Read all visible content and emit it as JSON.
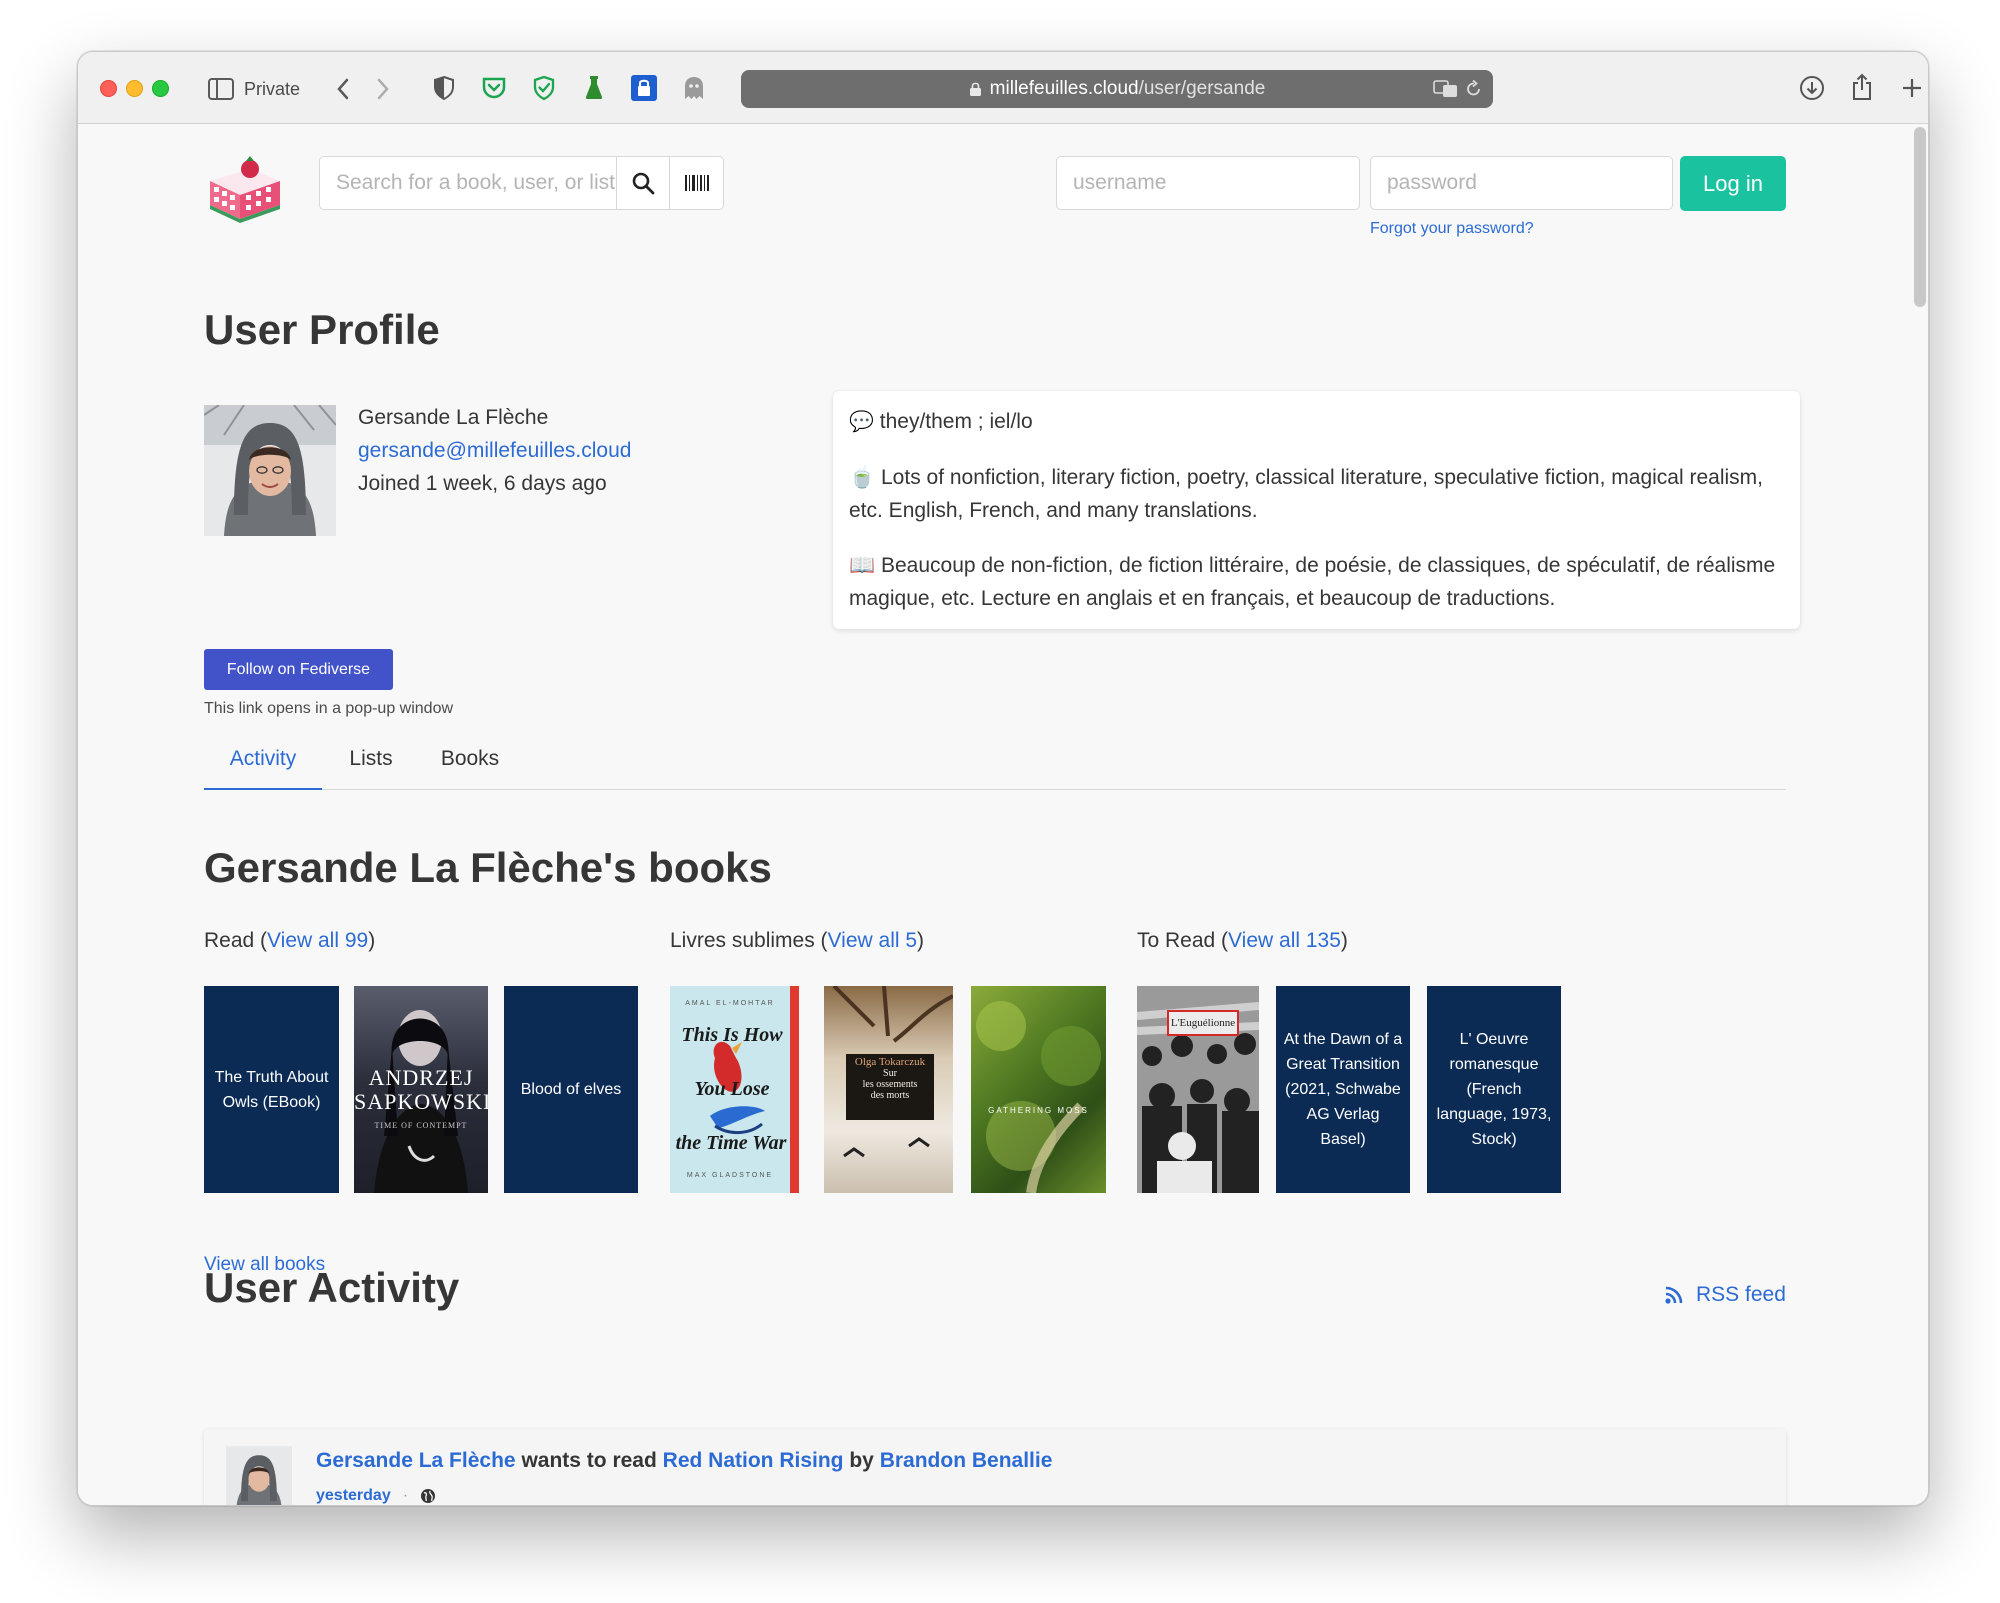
{
  "browser": {
    "private_label": "Private",
    "url_host": "millefeuilles.cloud",
    "url_path": "/user/gersande"
  },
  "header": {
    "search_placeholder": "Search for a book, user, or list",
    "username_placeholder": "username",
    "password_placeholder": "password",
    "login_label": "Log in",
    "forgot_label": "Forgot your password?"
  },
  "profile": {
    "page_title": "User Profile",
    "name": "Gersande La Flèche",
    "handle": "gersande@millefeuilles.cloud",
    "joined": "Joined 1 week, 6 days ago",
    "bio_pronouns": "they/them ; iel/lo",
    "bio_en": "Lots of nonfiction, literary fiction, poetry, classical literature, speculative fiction, magical realism, etc. English, French, and many translations.",
    "bio_fr": "Beaucoup de non-fiction, de fiction littéraire, de poésie, de classiques, de spéculatif, de réalisme magique, etc. Lecture en anglais et en français, et beaucoup de traductions.",
    "follow_label": "Follow on Fediverse",
    "follow_note": "This link opens in a pop-up window"
  },
  "tabs": [
    {
      "label": "Activity",
      "active": true
    },
    {
      "label": "Lists",
      "active": false
    },
    {
      "label": "Books",
      "active": false
    }
  ],
  "books_section": {
    "title": "Gersande La Flèche's books",
    "shelves": [
      {
        "name": "Read",
        "view_all": "View all 99"
      },
      {
        "name": "Livres sublimes",
        "view_all": "View all 5"
      },
      {
        "name": "To Read",
        "view_all": "View all 135"
      }
    ],
    "covers": {
      "owls": "The Truth About Owls (EBook)",
      "sapkowski_author": "Andrzej Sapkowski",
      "sapkowski_subtitle": "Time of Contempt",
      "elves": "Blood of elves",
      "timewar_author": "Amal El-Mohtar",
      "timewar_title_1": "This Is How",
      "timewar_title_2": "You Lose",
      "timewar_title_3": "the Time War",
      "timewar_author2": "Max Gladstone",
      "tokarczuk_author": "Olga Tokarczuk",
      "tokarczuk_title_1": "Sur",
      "tokarczuk_title_2": "les ossements",
      "tokarczuk_title_3": "des morts",
      "moss_title": "Gathering Moss",
      "euguelionne_title": "L'Euguélionne",
      "dawn": "At the Dawn of a Great Transition (2021, Schwabe AG Verlag Basel)",
      "oeuvre": "L' Oeuvre romanesque (French language, 1973, Stock)"
    },
    "view_all_books": "View all books"
  },
  "activity_section": {
    "title": "User Activity",
    "rss_label": "RSS feed",
    "items": [
      {
        "user": "Gersande La Flèche",
        "verb": "wants to read",
        "book": "Red Nation Rising",
        "by": "by",
        "author": "Brandon Benallie",
        "time": "yesterday",
        "separator": "·"
      }
    ]
  },
  "colors": {
    "accent_link": "#2c6bd4",
    "login_button": "#1bc2a0",
    "follow_button": "#4252c9",
    "cover_placeholder": "#0b2b55"
  }
}
